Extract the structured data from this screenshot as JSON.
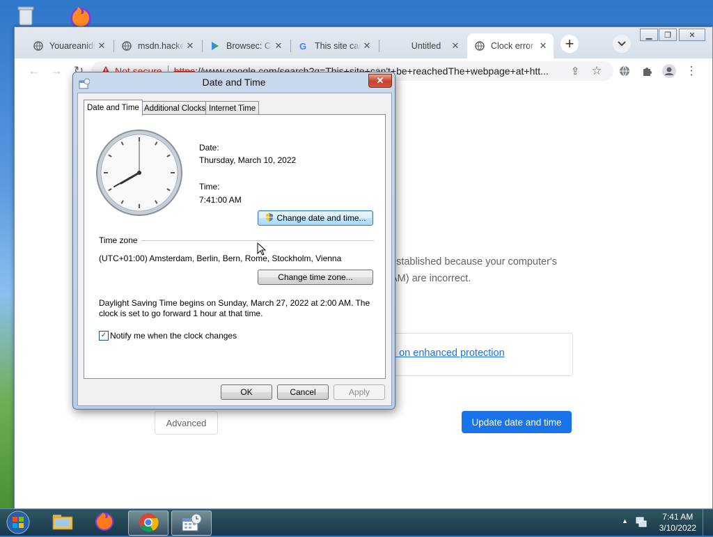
{
  "desktop": {
    "recycle_bin_icon": "recycle-bin-icon",
    "firefox_icon": "firefox-icon"
  },
  "browser": {
    "tabs": [
      {
        "title": "Youareanidiot",
        "icon": "globe-icon"
      },
      {
        "title": "msdn.hackerz",
        "icon": "globe-icon"
      },
      {
        "title": "Browsec: Cool",
        "icon": "play-store-icon"
      },
      {
        "title": "This site can't",
        "icon": "google-icon"
      },
      {
        "title": "Untitled",
        "icon": "blank-icon"
      },
      {
        "title": "Clock error",
        "icon": "globe-icon"
      }
    ],
    "tab_close": "✕",
    "new_tab": "+",
    "omnibox": {
      "security_label": "Not secure",
      "scheme": "https",
      "rest": "://www.google.com/search?q=This+site+can't+be+reachedThe+webpage+at+htt..."
    },
    "page": {
      "error_line1": "established because your computer's",
      "error_line2": "AM) are incorrect.",
      "protection_link": "n on enhanced protection",
      "advanced_button": "Advanced",
      "update_button": "Update date and time"
    }
  },
  "dialog": {
    "title": "Date and Time",
    "close": "✕",
    "tabs": [
      "Date and Time",
      "Additional Clocks",
      "Internet Time"
    ],
    "date_label": "Date:",
    "date_value": "Thursday, March 10, 2022",
    "time_label": "Time:",
    "time_value": "7:41:00 AM",
    "change_datetime_button": "Change date and time...",
    "timezone_header": "Time zone",
    "timezone_value": "(UTC+01:00) Amsterdam, Berlin, Bern, Rome, Stockholm, Vienna",
    "change_timezone_button": "Change time zone...",
    "dst_line1": "Daylight Saving Time begins on Sunday, March 27, 2022 at 2:00 AM. The",
    "dst_line2": "clock is set to go forward 1 hour at that time.",
    "notify_label": "Notify me when the clock changes",
    "notify_checked": true,
    "ok": "OK",
    "cancel": "Cancel",
    "apply": "Apply"
  },
  "taskbar": {
    "items": [
      "file-explorer-icon",
      "firefox-icon",
      "chrome-icon",
      "date-time-icon"
    ],
    "clock_time": "7:41 AM",
    "clock_date": "3/10/2022"
  }
}
